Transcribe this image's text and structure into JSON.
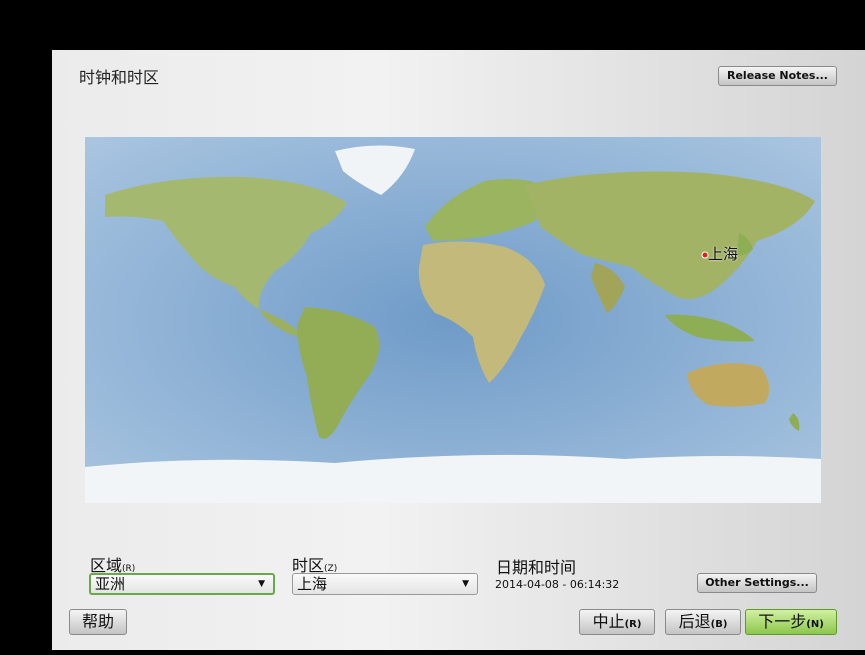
{
  "page_title": "时钟和时区",
  "buttons": {
    "release_notes": "Release Notes...",
    "other_settings": "Other Settings...",
    "help": "帮助",
    "abort": "中止",
    "abort_mnemonic": "(R)",
    "back": "后退",
    "back_mnemonic": "(B)",
    "next": "下一步",
    "next_mnemonic": "(N)"
  },
  "map": {
    "selected_city_label": "上海"
  },
  "region": {
    "label": "区域",
    "mnemonic": "(R)",
    "value": "亚洲"
  },
  "timezone": {
    "label": "时区",
    "mnemonic": "(Z)",
    "value": "上海"
  },
  "datetime": {
    "label": "日期和时间",
    "value": "2014-04-08 - 06:14:32"
  },
  "colors": {
    "ocean": "#8fb3d6",
    "land": "#9fb56a",
    "ice": "#f2f5f7",
    "next_button": "#a8d86a",
    "focus_border": "#6aa84a"
  }
}
